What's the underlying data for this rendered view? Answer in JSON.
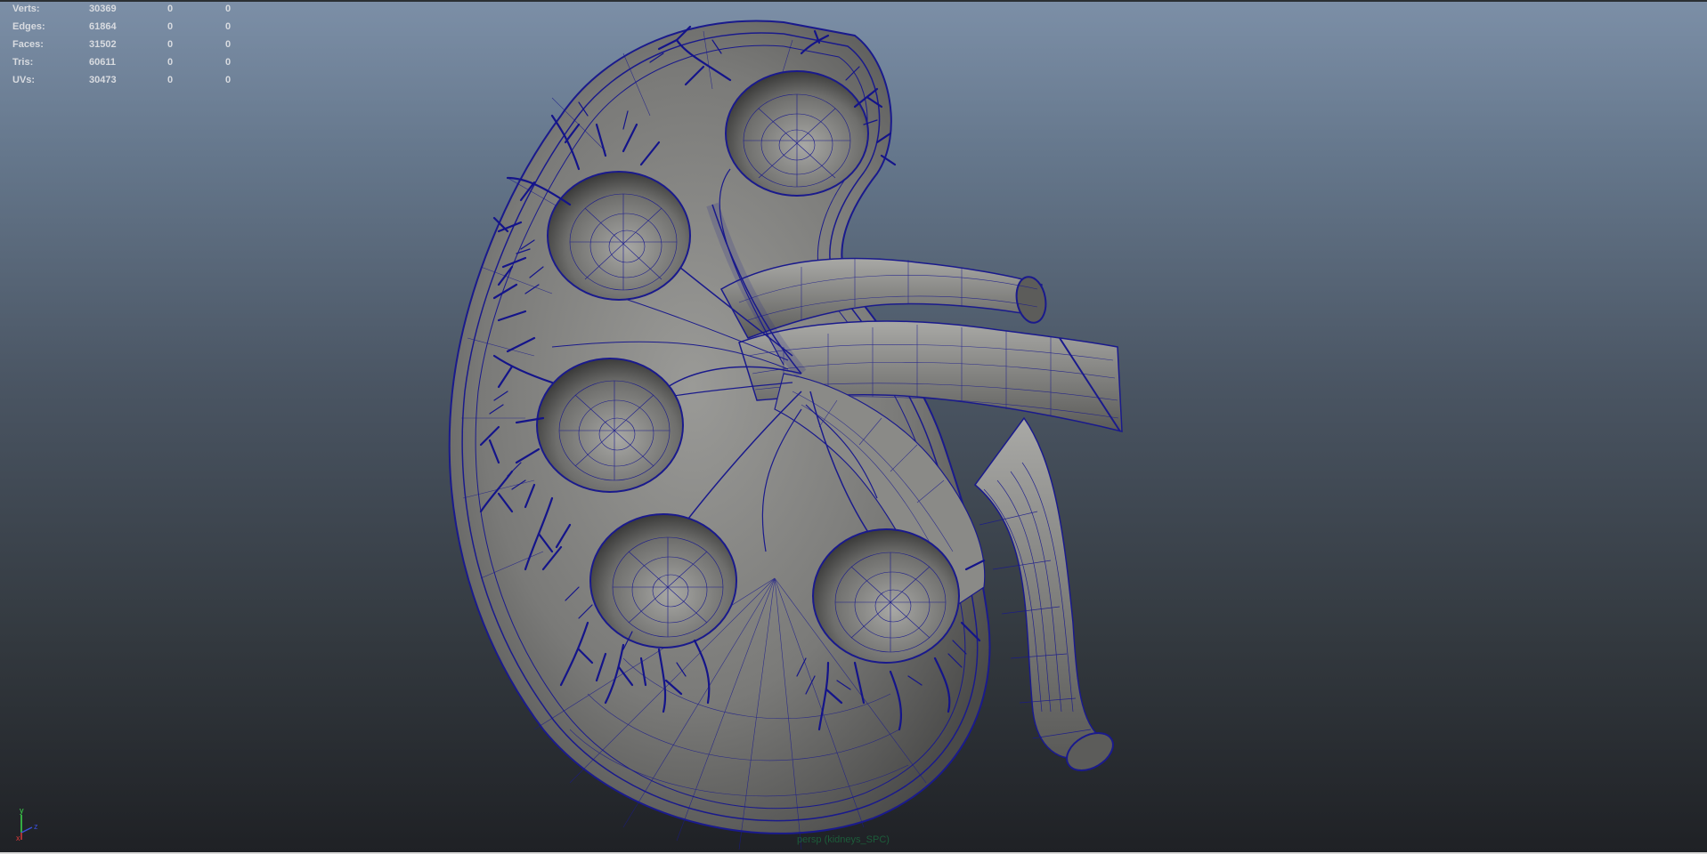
{
  "hud": {
    "rows": [
      {
        "label": "Verts:",
        "v1": "30369",
        "v2": "0",
        "v3": "0"
      },
      {
        "label": "Edges:",
        "v1": "61864",
        "v2": "0",
        "v3": "0"
      },
      {
        "label": "Faces:",
        "v1": "31502",
        "v2": "0",
        "v3": "0"
      },
      {
        "label": "Tris:",
        "v1": "60611",
        "v2": "0",
        "v3": "0"
      },
      {
        "label": "UVs:",
        "v1": "30473",
        "v2": "0",
        "v3": "0"
      }
    ]
  },
  "camera_label": "persp (kidneys_SPC)",
  "axis": {
    "y": "y",
    "z": "z",
    "x": "x"
  },
  "colors": {
    "wire": "#1a1a8c",
    "surface": "#7b7b79",
    "vessels": "#14148a"
  }
}
